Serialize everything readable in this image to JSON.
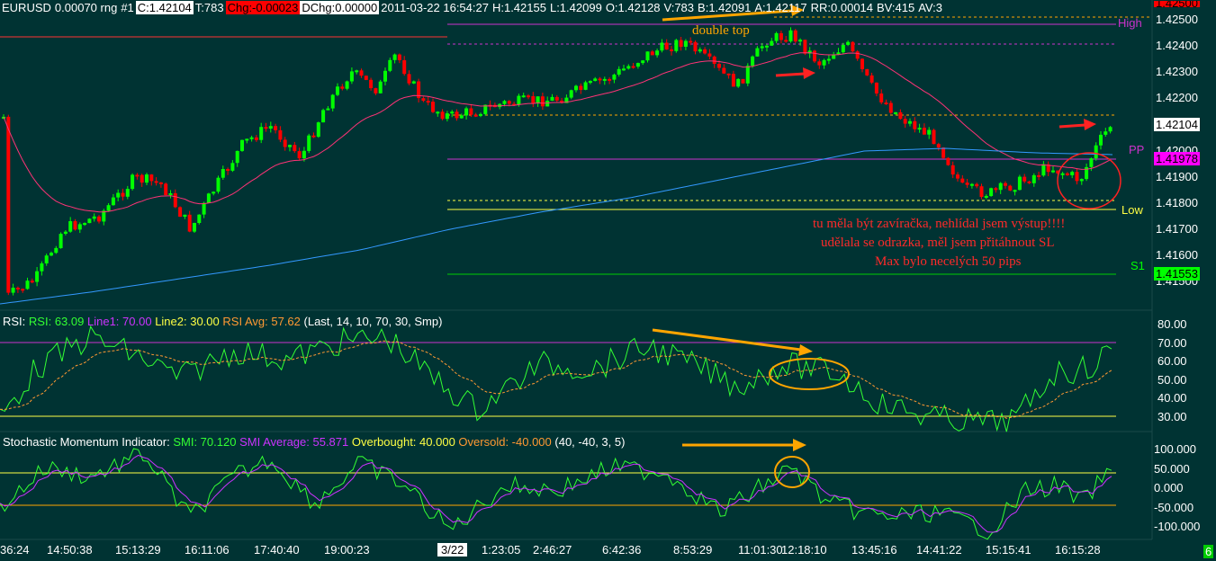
{
  "header": {
    "symbol": "EURUSD",
    "range": "0.00070 rng",
    "instance": "#1",
    "close": "C:1.42104",
    "ticks": "T:783",
    "chg": "Chg:-0.00023",
    "dchg": "DChg:0.00000",
    "datetime": "2011-03-22 16:54:27",
    "high": "H:1.42155",
    "low": "L:1.42099",
    "open": "O:1.42128",
    "volume": "V:783",
    "bid": "B:1.42091",
    "ask": "A:1.42117",
    "rr": "RR:0.00014",
    "bv": "BV:415",
    "av": "AV:3"
  },
  "levels": {
    "high_label": "High",
    "pp_label": "PP",
    "low_label": "Low",
    "s1_label": "S1",
    "pp_value": "1.41978",
    "s1_value": "1.41553",
    "last_value": "1.42104",
    "top_value": "1.42500"
  },
  "price_axis": [
    "1.42500",
    "1.42400",
    "1.42300",
    "1.42200",
    "1.42100",
    "1.42000",
    "1.41900",
    "1.41800",
    "1.41700",
    "1.41600",
    "1.41500"
  ],
  "annotations": {
    "double_top": "double top",
    "note_line1": "tu měla být zavíračka, nehlídal jsem výstup!!!!",
    "note_line2": "udělala se odrazka, měl jsem přitáhnout SL",
    "note_line3": "Max bylo necelých 50 pips"
  },
  "rsi": {
    "title": "RSI:",
    "rsi": "RSI: 63.09",
    "line1": "Line1: 70.00",
    "line2": "Line2: 30.00",
    "avg": "RSI Avg: 57.62",
    "params": "(Last, 14, 10, 70, 30, Smp)",
    "axis": [
      "80.00",
      "70.00",
      "60.00",
      "50.00",
      "40.00",
      "30.00"
    ]
  },
  "smi": {
    "title": "Stochastic Momentum Indicator:",
    "smi": "SMI: 70.120",
    "avg": "SMI Average: 55.871",
    "ob": "Overbought: 40.000",
    "os": "Oversold: -40.000",
    "params": "(40, -40, 3, 5)",
    "axis": [
      "100.000",
      "50.000",
      "0.000",
      "-50.000",
      "-100.000"
    ]
  },
  "time_axis": [
    "36:24",
    "14:50:38",
    "15:13:29",
    "16:11:06",
    "17:40:40",
    "19:00:23",
    "3/22",
    "1:23:05",
    "2:46:27",
    "6:42:36",
    "8:53:29",
    "11:01:30",
    "12:18:10",
    "13:45:16",
    "14:41:22",
    "15:15:41",
    "16:15:28"
  ],
  "corner_badge": "6",
  "colors": {
    "background": "#003333",
    "up_candle": "#00ff00",
    "down_candle": "#ff0000",
    "ma_short": "#ff3377",
    "ma_long": "#3399ff",
    "arrow_orange": "#ffa500",
    "level_magenta": "#cc00cc",
    "level_yellow": "#ffff44",
    "s1_green": "#00cc00"
  }
}
